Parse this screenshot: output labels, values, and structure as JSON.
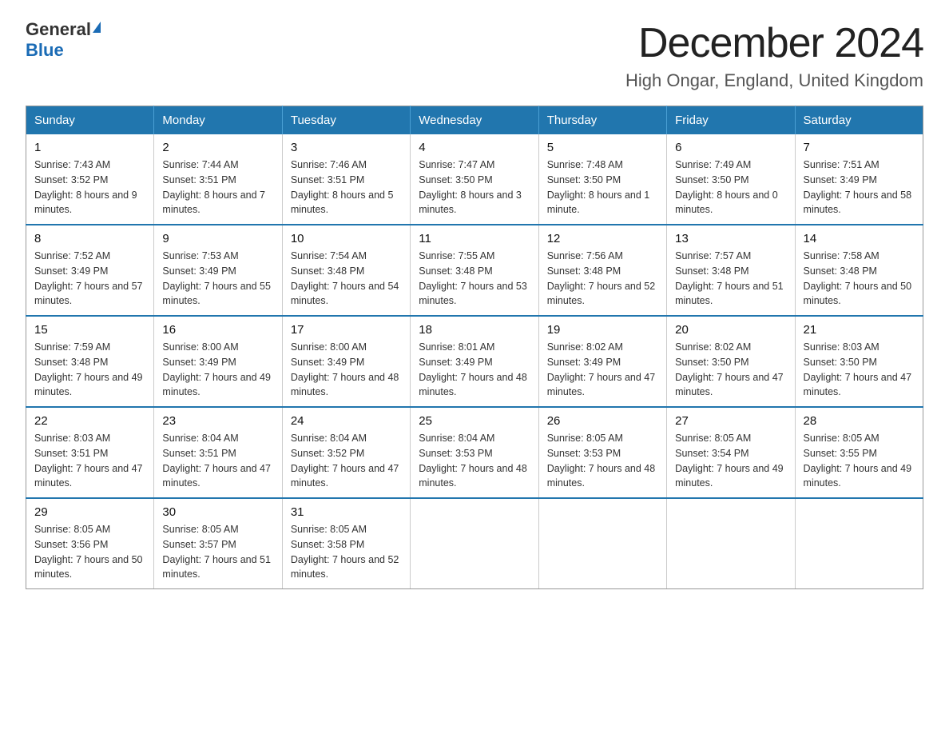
{
  "header": {
    "logo_general": "General",
    "logo_blue": "Blue",
    "title": "December 2024",
    "subtitle": "High Ongar, England, United Kingdom"
  },
  "days_of_week": [
    "Sunday",
    "Monday",
    "Tuesday",
    "Wednesday",
    "Thursday",
    "Friday",
    "Saturday"
  ],
  "weeks": [
    [
      {
        "day": "1",
        "sunrise": "7:43 AM",
        "sunset": "3:52 PM",
        "daylight": "8 hours and 9 minutes."
      },
      {
        "day": "2",
        "sunrise": "7:44 AM",
        "sunset": "3:51 PM",
        "daylight": "8 hours and 7 minutes."
      },
      {
        "day": "3",
        "sunrise": "7:46 AM",
        "sunset": "3:51 PM",
        "daylight": "8 hours and 5 minutes."
      },
      {
        "day": "4",
        "sunrise": "7:47 AM",
        "sunset": "3:50 PM",
        "daylight": "8 hours and 3 minutes."
      },
      {
        "day": "5",
        "sunrise": "7:48 AM",
        "sunset": "3:50 PM",
        "daylight": "8 hours and 1 minute."
      },
      {
        "day": "6",
        "sunrise": "7:49 AM",
        "sunset": "3:50 PM",
        "daylight": "8 hours and 0 minutes."
      },
      {
        "day": "7",
        "sunrise": "7:51 AM",
        "sunset": "3:49 PM",
        "daylight": "7 hours and 58 minutes."
      }
    ],
    [
      {
        "day": "8",
        "sunrise": "7:52 AM",
        "sunset": "3:49 PM",
        "daylight": "7 hours and 57 minutes."
      },
      {
        "day": "9",
        "sunrise": "7:53 AM",
        "sunset": "3:49 PM",
        "daylight": "7 hours and 55 minutes."
      },
      {
        "day": "10",
        "sunrise": "7:54 AM",
        "sunset": "3:48 PM",
        "daylight": "7 hours and 54 minutes."
      },
      {
        "day": "11",
        "sunrise": "7:55 AM",
        "sunset": "3:48 PM",
        "daylight": "7 hours and 53 minutes."
      },
      {
        "day": "12",
        "sunrise": "7:56 AM",
        "sunset": "3:48 PM",
        "daylight": "7 hours and 52 minutes."
      },
      {
        "day": "13",
        "sunrise": "7:57 AM",
        "sunset": "3:48 PM",
        "daylight": "7 hours and 51 minutes."
      },
      {
        "day": "14",
        "sunrise": "7:58 AM",
        "sunset": "3:48 PM",
        "daylight": "7 hours and 50 minutes."
      }
    ],
    [
      {
        "day": "15",
        "sunrise": "7:59 AM",
        "sunset": "3:48 PM",
        "daylight": "7 hours and 49 minutes."
      },
      {
        "day": "16",
        "sunrise": "8:00 AM",
        "sunset": "3:49 PM",
        "daylight": "7 hours and 49 minutes."
      },
      {
        "day": "17",
        "sunrise": "8:00 AM",
        "sunset": "3:49 PM",
        "daylight": "7 hours and 48 minutes."
      },
      {
        "day": "18",
        "sunrise": "8:01 AM",
        "sunset": "3:49 PM",
        "daylight": "7 hours and 48 minutes."
      },
      {
        "day": "19",
        "sunrise": "8:02 AM",
        "sunset": "3:49 PM",
        "daylight": "7 hours and 47 minutes."
      },
      {
        "day": "20",
        "sunrise": "8:02 AM",
        "sunset": "3:50 PM",
        "daylight": "7 hours and 47 minutes."
      },
      {
        "day": "21",
        "sunrise": "8:03 AM",
        "sunset": "3:50 PM",
        "daylight": "7 hours and 47 minutes."
      }
    ],
    [
      {
        "day": "22",
        "sunrise": "8:03 AM",
        "sunset": "3:51 PM",
        "daylight": "7 hours and 47 minutes."
      },
      {
        "day": "23",
        "sunrise": "8:04 AM",
        "sunset": "3:51 PM",
        "daylight": "7 hours and 47 minutes."
      },
      {
        "day": "24",
        "sunrise": "8:04 AM",
        "sunset": "3:52 PM",
        "daylight": "7 hours and 47 minutes."
      },
      {
        "day": "25",
        "sunrise": "8:04 AM",
        "sunset": "3:53 PM",
        "daylight": "7 hours and 48 minutes."
      },
      {
        "day": "26",
        "sunrise": "8:05 AM",
        "sunset": "3:53 PM",
        "daylight": "7 hours and 48 minutes."
      },
      {
        "day": "27",
        "sunrise": "8:05 AM",
        "sunset": "3:54 PM",
        "daylight": "7 hours and 49 minutes."
      },
      {
        "day": "28",
        "sunrise": "8:05 AM",
        "sunset": "3:55 PM",
        "daylight": "7 hours and 49 minutes."
      }
    ],
    [
      {
        "day": "29",
        "sunrise": "8:05 AM",
        "sunset": "3:56 PM",
        "daylight": "7 hours and 50 minutes."
      },
      {
        "day": "30",
        "sunrise": "8:05 AM",
        "sunset": "3:57 PM",
        "daylight": "7 hours and 51 minutes."
      },
      {
        "day": "31",
        "sunrise": "8:05 AM",
        "sunset": "3:58 PM",
        "daylight": "7 hours and 52 minutes."
      },
      null,
      null,
      null,
      null
    ]
  ]
}
